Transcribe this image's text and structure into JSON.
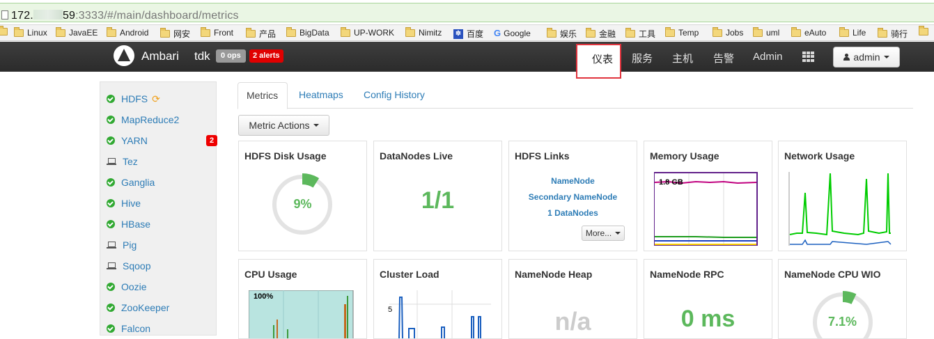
{
  "browser": {
    "url_prefix": "172.",
    "url_mid": "59",
    "url_rest": ":3333/#/main/dashboard/metrics"
  },
  "bookmarks": [
    {
      "label": "Linux",
      "icon": "folder-icon"
    },
    {
      "label": "JavaEE",
      "icon": "folder-icon"
    },
    {
      "label": "Android",
      "icon": "folder-icon"
    },
    {
      "label": "网安",
      "icon": "folder-icon"
    },
    {
      "label": "Front",
      "icon": "folder-icon"
    },
    {
      "label": "产品",
      "icon": "folder-icon"
    },
    {
      "label": "BigData",
      "icon": "folder-icon"
    },
    {
      "label": "UP-WORK",
      "icon": "folder-icon"
    },
    {
      "label": "Nimitz",
      "icon": "folder-icon"
    },
    {
      "label": "百度",
      "icon": "baidu-icon"
    },
    {
      "label": "Google",
      "icon": "google-icon"
    },
    {
      "label": "娱乐",
      "icon": "folder-icon"
    },
    {
      "label": "金融",
      "icon": "folder-icon"
    },
    {
      "label": "工具",
      "icon": "folder-icon"
    },
    {
      "label": "Temp",
      "icon": "folder-icon"
    },
    {
      "label": "Jobs",
      "icon": "folder-icon"
    },
    {
      "label": "uml",
      "icon": "folder-icon"
    },
    {
      "label": "eAuto",
      "icon": "folder-icon"
    },
    {
      "label": "Life",
      "icon": "folder-icon"
    },
    {
      "label": "骑行",
      "icon": "folder-icon"
    }
  ],
  "navbar": {
    "brand": "Ambari",
    "cluster": "tdk",
    "ops_badge": "0 ops",
    "alerts_badge": "2 alerts",
    "links": [
      "仪表",
      "服务",
      "主机",
      "告警",
      "Admin"
    ],
    "user_button": "admin"
  },
  "sidebar": {
    "services": [
      {
        "name": "HDFS",
        "status": "ok",
        "refresh": true
      },
      {
        "name": "MapReduce2",
        "status": "ok"
      },
      {
        "name": "YARN",
        "status": "ok",
        "badge": "2"
      },
      {
        "name": "Tez",
        "status": "client"
      },
      {
        "name": "Ganglia",
        "status": "ok"
      },
      {
        "name": "Hive",
        "status": "ok"
      },
      {
        "name": "HBase",
        "status": "ok"
      },
      {
        "name": "Pig",
        "status": "client"
      },
      {
        "name": "Sqoop",
        "status": "client"
      },
      {
        "name": "Oozie",
        "status": "ok"
      },
      {
        "name": "ZooKeeper",
        "status": "ok"
      },
      {
        "name": "Falcon",
        "status": "ok"
      }
    ]
  },
  "tabs": [
    "Metrics",
    "Heatmaps",
    "Config History"
  ],
  "metric_actions": "Metric Actions",
  "widgets": {
    "hdfs_disk": {
      "title": "HDFS Disk Usage",
      "value": "9%",
      "fraction": 0.09
    },
    "datanodes": {
      "title": "DataNodes Live",
      "value": "1/1"
    },
    "hdfs_links": {
      "title": "HDFS Links",
      "links": [
        "NameNode",
        "Secondary NameNode",
        "1 DataNodes"
      ],
      "more": "More..."
    },
    "memory": {
      "title": "Memory Usage",
      "label": "1.8 GB"
    },
    "network": {
      "title": "Network Usage"
    },
    "cpu": {
      "title": "CPU Usage",
      "label": "100%"
    },
    "cluster_load": {
      "title": "Cluster Load",
      "label": "5"
    },
    "nn_heap": {
      "title": "NameNode Heap",
      "value": "n/a"
    },
    "nn_rpc": {
      "title": "NameNode RPC",
      "value": "0 ms"
    },
    "nn_cpu": {
      "title": "NameNode CPU WIO",
      "value": "7.1%",
      "fraction": 0.071
    }
  },
  "colors": {
    "green": "#5cb85c",
    "link": "#2d7cb6",
    "alert": "#e00000"
  }
}
